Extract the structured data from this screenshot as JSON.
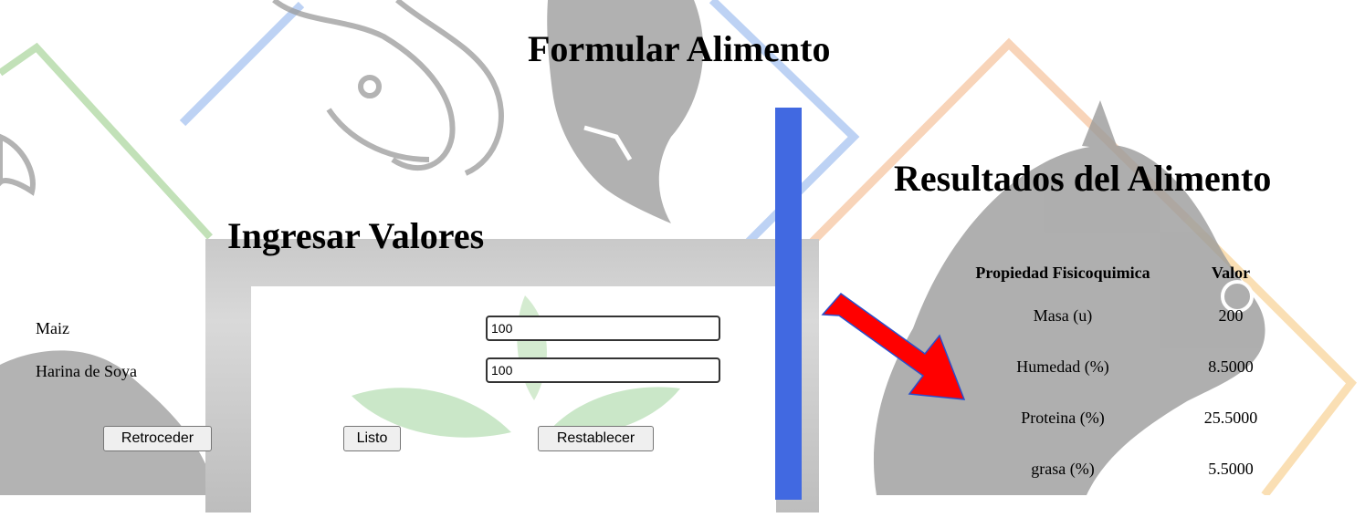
{
  "page": {
    "title": "Formular Alimento"
  },
  "input_panel": {
    "heading": "Ingresar Valores",
    "fields": [
      {
        "label": "Maiz",
        "value": "100"
      },
      {
        "label": "Harina de Soya",
        "value": "100"
      }
    ],
    "buttons": {
      "back": "Retroceder",
      "done": "Listo",
      "reset": "Restablecer"
    }
  },
  "results_panel": {
    "heading": "Resultados del Alimento",
    "columns": [
      "Propiedad Fisicoquimica",
      "Valor"
    ],
    "rows": [
      {
        "property": "Masa (u)",
        "value": "200"
      },
      {
        "property": "Humedad (%)",
        "value": "8.5000"
      },
      {
        "property": "Proteina (%)",
        "value": "25.5000"
      },
      {
        "property": "grasa (%)",
        "value": "5.5000"
      }
    ]
  },
  "colors": {
    "divider": "#4169e1",
    "arrow": "#ff0000"
  }
}
